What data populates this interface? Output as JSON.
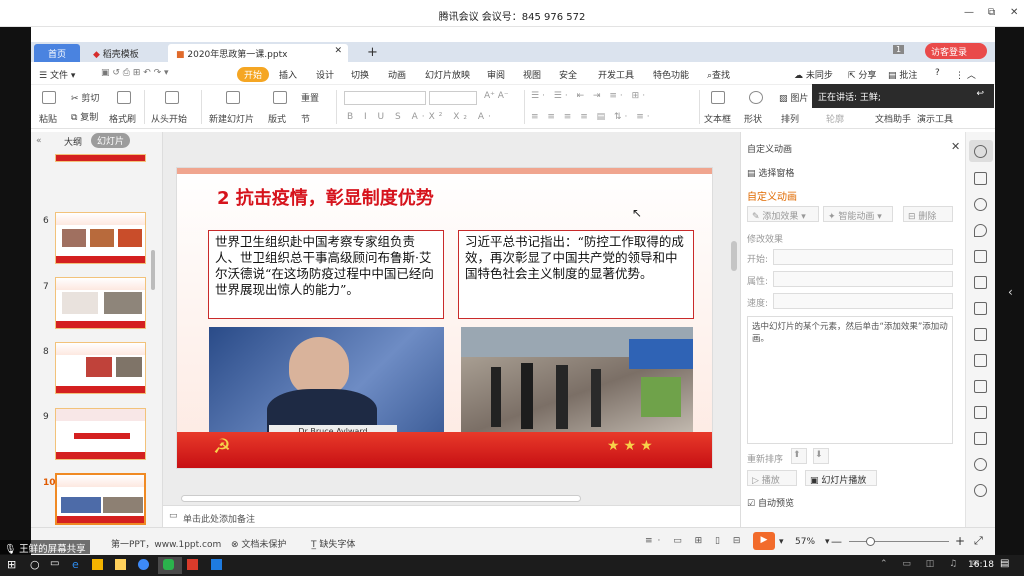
{
  "meeting": {
    "title": "腾讯会议 会议号：845 976 572",
    "min": "—",
    "restore": "⧉",
    "close": "✕",
    "screen_share": "王鲜的屏幕共享",
    "speaking": "正在讲话: 王鲜;"
  },
  "tabs": {
    "home": "首页",
    "template": "稻壳模板",
    "doc": "2020年思政第一课.pptx",
    "add": "+",
    "login": "访客登录",
    "count": "1"
  },
  "menu": {
    "file": "文件",
    "start": "开始",
    "insert": "插入",
    "design": "设计",
    "transition": "切换",
    "animation": "动画",
    "slideshow": "幻灯片放映",
    "review": "审阅",
    "view": "视图",
    "security": "安全",
    "devtools": "开发工具",
    "special": "特色功能",
    "search": "查找",
    "sync": "未同步",
    "share": "分享",
    "annotate": "批注",
    "help": "?"
  },
  "ribbon": {
    "paste": "粘贴",
    "cut": "剪切",
    "copy": "复制",
    "format_painter": "格式刷",
    "from_start": "从头开始",
    "new_slide": "新建幻灯片",
    "layout": "版式",
    "section": "节",
    "reset": "重置",
    "textbox": "文本框",
    "shape": "形状",
    "arrange": "排列",
    "outline": "轮廓",
    "doc_helper": "文档助手",
    "present_tool": "演示工具",
    "picture": "图片"
  },
  "thumbs_header": {
    "outline": "大纲",
    "slides": "幻灯片"
  },
  "thumb_numbers": [
    "6",
    "7",
    "8",
    "9",
    "10"
  ],
  "slide": {
    "title": "2 抗击疫情，彰显制度优势",
    "left_text": "世界卫生组织赴中国考察专家组负责人、世卫组织总干事高级顾问布鲁斯·艾尔沃德说“在这场防疫过程中中国已经向世界展现出惊人的能力”。",
    "right_text": "习近平总书记指出：“防控工作取得的成效，再次彰显了中国共产党的领导和中国特色社会主义制度的显著优势。",
    "caption": "Dr Bruce Aylward"
  },
  "notes_placeholder": "单击此处添加备注",
  "pane": {
    "title": "自定义动画",
    "select_pane": "选择窗格",
    "custom_anim": "自定义动画",
    "add_effect": "添加效果",
    "smart_anim": "智能动画",
    "delete": "删除",
    "modify_effect": "修改效果",
    "start": "开始:",
    "property": "属性:",
    "speed": "速度:",
    "hint": "选中幻灯片的某个元素，然后单击“添加效果”添加动画。",
    "reorder": "重新排序",
    "play": "播放",
    "slideshow": "幻灯片播放",
    "autopreview": "自动预览"
  },
  "status": {
    "slide_label": "第一PPT，www.1ppt.com",
    "doc_unprotected": "文档未保护",
    "missing_font": "缺失字体",
    "zoom": "57%"
  },
  "taskbar": {
    "time": "16:18"
  }
}
